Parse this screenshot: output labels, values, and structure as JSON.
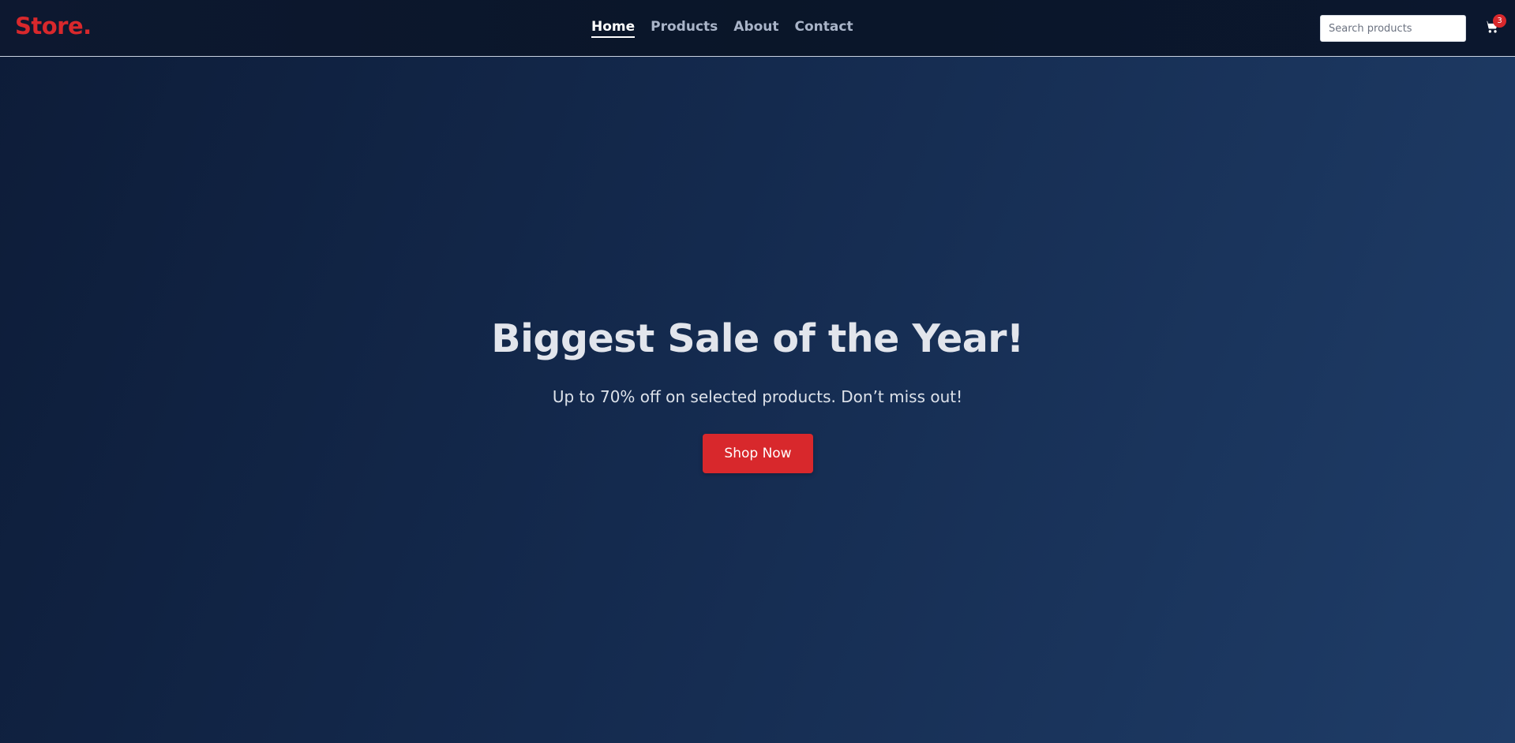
{
  "header": {
    "logo": "Store.",
    "nav": [
      {
        "label": "Home",
        "active": true
      },
      {
        "label": "Products",
        "active": false
      },
      {
        "label": "About",
        "active": false
      },
      {
        "label": "Contact",
        "active": false
      }
    ],
    "search": {
      "placeholder": "Search products",
      "value": ""
    },
    "cart": {
      "icon": "cart-icon",
      "count": "3"
    }
  },
  "hero": {
    "title": "Biggest Sale of the Year!",
    "subtitle": "Up to 70% off on selected products. Don’t miss out!",
    "button_label": "Shop Now"
  },
  "colors": {
    "accent": "#d8282c",
    "nav_background": "#0a1629",
    "hero_gradient_start": "#0d1c38",
    "hero_gradient_end": "#1f3d68"
  }
}
